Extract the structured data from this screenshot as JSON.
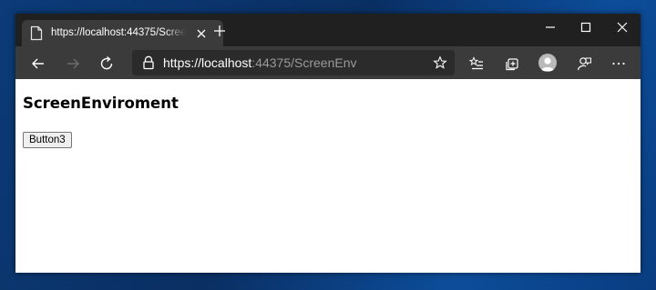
{
  "browser": {
    "tab_title": "https://localhost:44375/ScreenEnv",
    "url_host": "https://localhost",
    "url_path": ":44375/ScreenEnv"
  },
  "page": {
    "heading": "ScreenEnviroment",
    "button_label": "Button3"
  },
  "icons": {
    "tab": "page-icon",
    "close": "close-icon",
    "new_tab": "plus-icon",
    "back": "back-arrow-icon",
    "forward": "forward-arrow-icon",
    "refresh": "refresh-icon",
    "lock": "lock-icon",
    "favorite": "star-icon",
    "favorites": "favorites-list-icon",
    "collections": "collections-icon",
    "profile": "profile-avatar-icon",
    "feedback": "feedback-icon",
    "menu": "more-icon"
  },
  "colors": {
    "tabstrip": "#202020",
    "toolbar": "#3b3b3b",
    "omnibox": "#2b2b2b",
    "desktop": "#0b3b78"
  }
}
